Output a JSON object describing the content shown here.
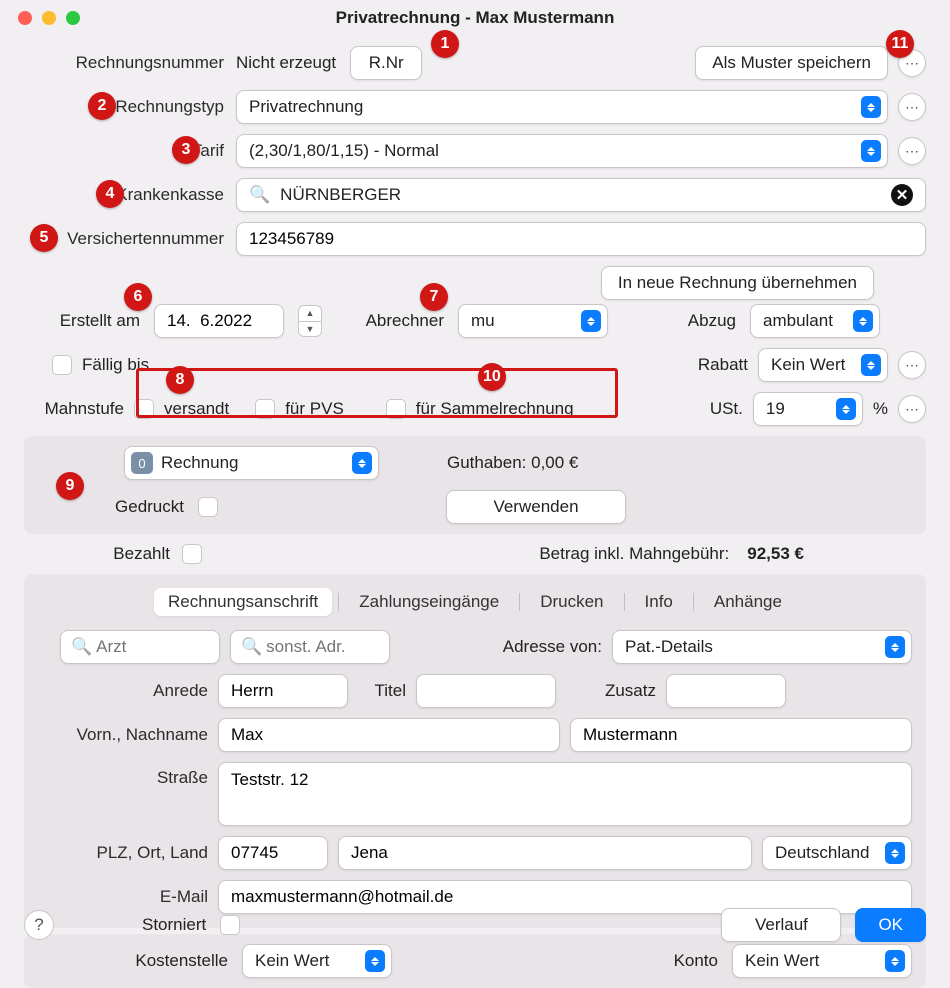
{
  "window": {
    "title": "Privatrechnung - Max Mustermann"
  },
  "annotations": {
    "b1": "1",
    "b2": "2",
    "b3": "3",
    "b4": "4",
    "b5": "5",
    "b6": "6",
    "b7": "7",
    "b8": "8",
    "b9": "9",
    "b10": "10",
    "b11": "11"
  },
  "top": {
    "rechnungsnummer_label": "Rechnungsnummer",
    "nicht_erzeugt": "Nicht erzeugt",
    "rnr_btn": "R.Nr",
    "als_muster": "Als Muster speichern",
    "rechnungstyp_label": "Rechnungstyp",
    "rechnungstyp_value": "Privatrechnung",
    "tarif_label": "Tarif",
    "tarif_value": "(2,30/1,80/1,15) - Normal",
    "krankenkasse_label": "Krankenkasse",
    "krankenkasse_value": "NÜRNBERGER",
    "vers_label": "Versichertennummer",
    "vers_value": "123456789",
    "in_neue": "In neue Rechnung übernehmen",
    "erstellt_label": "Erstellt am",
    "erstellt_value": "14.  6.2022",
    "abrechner_label": "Abrechner",
    "abrechner_value": "mu",
    "abzug_label": "Abzug",
    "abzug_value": "ambulant",
    "faellig_label": "Fällig bis",
    "rabatt_label": "Rabatt",
    "rabatt_value": "Kein Wert",
    "mahn_label": "Mahnstufe",
    "chk_versandt": "versandt",
    "chk_pvs": "für PVS",
    "chk_sammel": "für Sammelrechnung",
    "ust_label": "USt.",
    "ust_value": "19",
    "ust_percent": "%"
  },
  "rech_block": {
    "rechnung_icon": "0",
    "rechnung_value": "Rechnung",
    "guthaben": "Guthaben: 0,00 €",
    "gedruckt_label": "Gedruckt",
    "verwenden": "Verwenden"
  },
  "paid": {
    "bezahlt_label": "Bezahlt",
    "betrag_label": "Betrag inkl. Mahngebühr:",
    "betrag_value": "92,53 €"
  },
  "tabs": {
    "t1": "Rechnungsanschrift",
    "t2": "Zahlungseingänge",
    "t3": "Drucken",
    "t4": "Info",
    "t5": "Anhänge"
  },
  "addr": {
    "arzt_ph": "Arzt",
    "sonst_ph": "sonst. Adr.",
    "adresse_von": "Adresse von:",
    "adresse_value": "Pat.-Details",
    "anrede_label": "Anrede",
    "anrede": "Herrn",
    "titel_label": "Titel",
    "titel": "",
    "zusatz_label": "Zusatz",
    "zusatz": "",
    "vorname_label": "Vorn., Nachname",
    "vorname": "Max",
    "nachname": "Mustermann",
    "strasse_label": "Straße",
    "strasse": "Teststr. 12",
    "plz_label": "PLZ, Ort, Land",
    "plz": "07745",
    "ort": "Jena",
    "land": "Deutschland",
    "email_label": "E-Mail",
    "email": "maxmustermann@hotmail.de"
  },
  "bottom": {
    "kostenstelle_label": "Kostenstelle",
    "kostenstelle": "Kein Wert",
    "konto_label": "Konto",
    "konto": "Kein Wert",
    "storniert_label": "Storniert",
    "verlauf": "Verlauf",
    "ok": "OK"
  }
}
